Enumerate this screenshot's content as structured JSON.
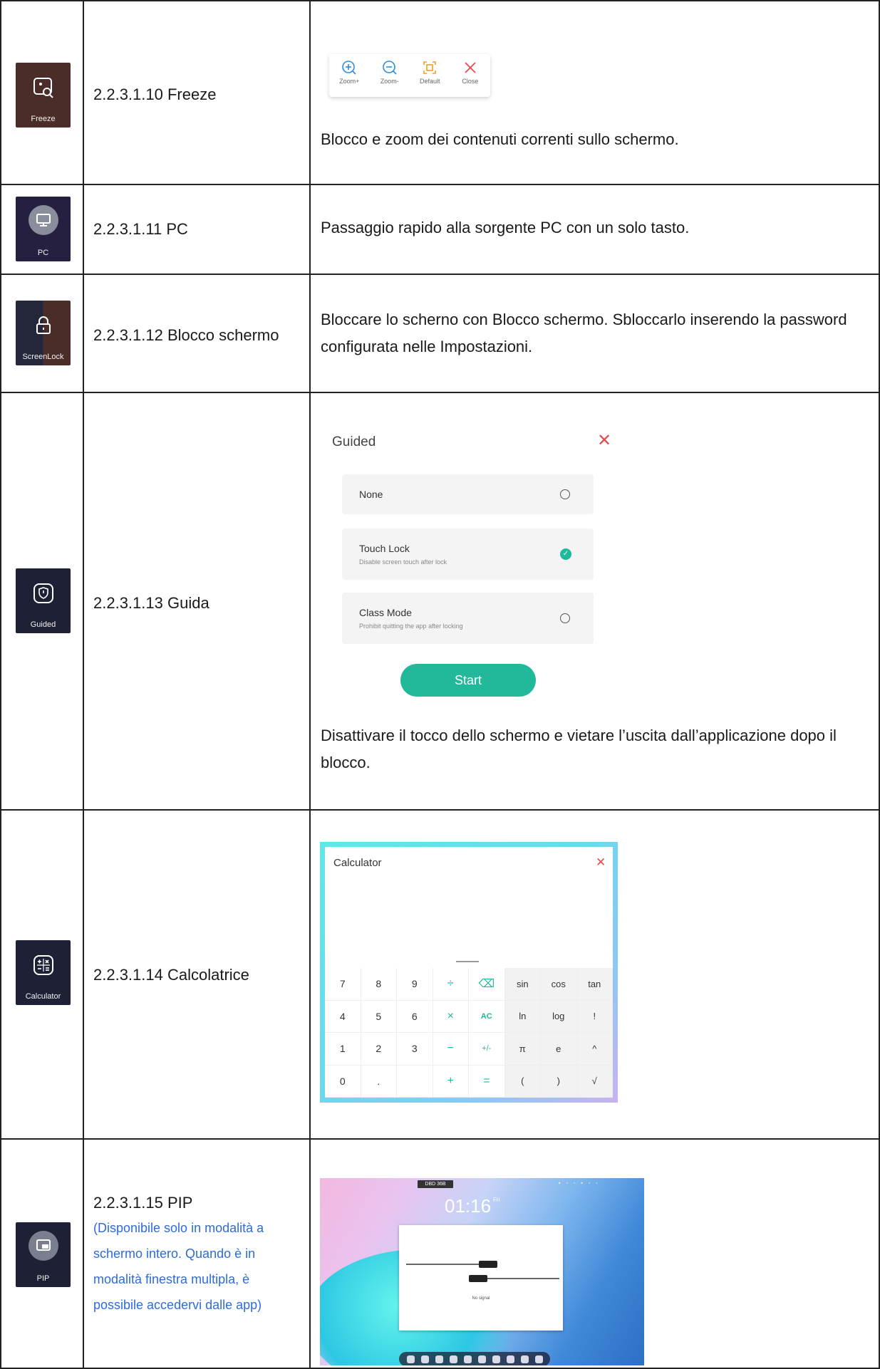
{
  "rows": [
    {
      "icon_caption": "Freeze",
      "title": "2.2.3.1.10 Freeze",
      "toolbar": [
        {
          "label": "Zoom+",
          "icon": "zoom-in-icon"
        },
        {
          "label": "Zoom-",
          "icon": "zoom-out-icon"
        },
        {
          "label": "Default",
          "icon": "fit-icon"
        },
        {
          "label": "Close",
          "icon": "close-icon"
        }
      ],
      "description": "Blocco e zoom dei contenuti correnti sullo schermo."
    },
    {
      "icon_caption": "PC",
      "title": "2.2.3.1.11 PC",
      "description": "Passaggio rapido alla sorgente PC con un solo tasto."
    },
    {
      "icon_caption": "ScreenLock",
      "title": "2.2.3.1.12 Blocco schermo",
      "description": "Bloccare lo scherno con Blocco schermo. Sbloccarlo inserendo la password configurata nelle Impostazioni."
    },
    {
      "icon_caption": "Guided",
      "title": "2.2.3.1.13 Guida",
      "dialog": {
        "title": "Guided",
        "options": [
          {
            "title": "None",
            "subtitle": "",
            "selected": false
          },
          {
            "title": "Touch Lock",
            "subtitle": "Disable screen touch after lock",
            "selected": true
          },
          {
            "title": "Class Mode",
            "subtitle": "Prohibit quitting the app after locking",
            "selected": false
          }
        ],
        "start": "Start"
      },
      "description": "Disattivare il tocco dello schermo e vietare l’uscita dall’applicazione dopo il blocco."
    },
    {
      "icon_caption": "Calculator",
      "title": "2.2.3.1.14 Calcolatrice",
      "calculator": {
        "title": "Calculator",
        "keys": [
          [
            "7",
            "8",
            "9",
            "÷",
            "⌫",
            "sin",
            "cos",
            "tan"
          ],
          [
            "4",
            "5",
            "6",
            "×",
            "AC",
            "ln",
            "log",
            "!"
          ],
          [
            "1",
            "2",
            "3",
            "−",
            "+/-",
            "π",
            "e",
            "^"
          ],
          [
            "0",
            ".",
            "",
            "+",
            "=",
            "(",
            ")",
            "√"
          ]
        ]
      }
    },
    {
      "icon_caption": "PIP",
      "title": "2.2.3.1.15 PIP",
      "note": "(Disponibile solo in modalità a schermo intero. Quando è in modalità finestra multipla, è possibile accedervi dalle app)",
      "screen": {
        "time": "01:16",
        "day": "Fri",
        "signal": "No signal",
        "badge": "DBD 36B"
      }
    }
  ],
  "colors": {
    "note": "#2f6bd6",
    "accent": "#22b99a",
    "close": "#e74c4c"
  }
}
